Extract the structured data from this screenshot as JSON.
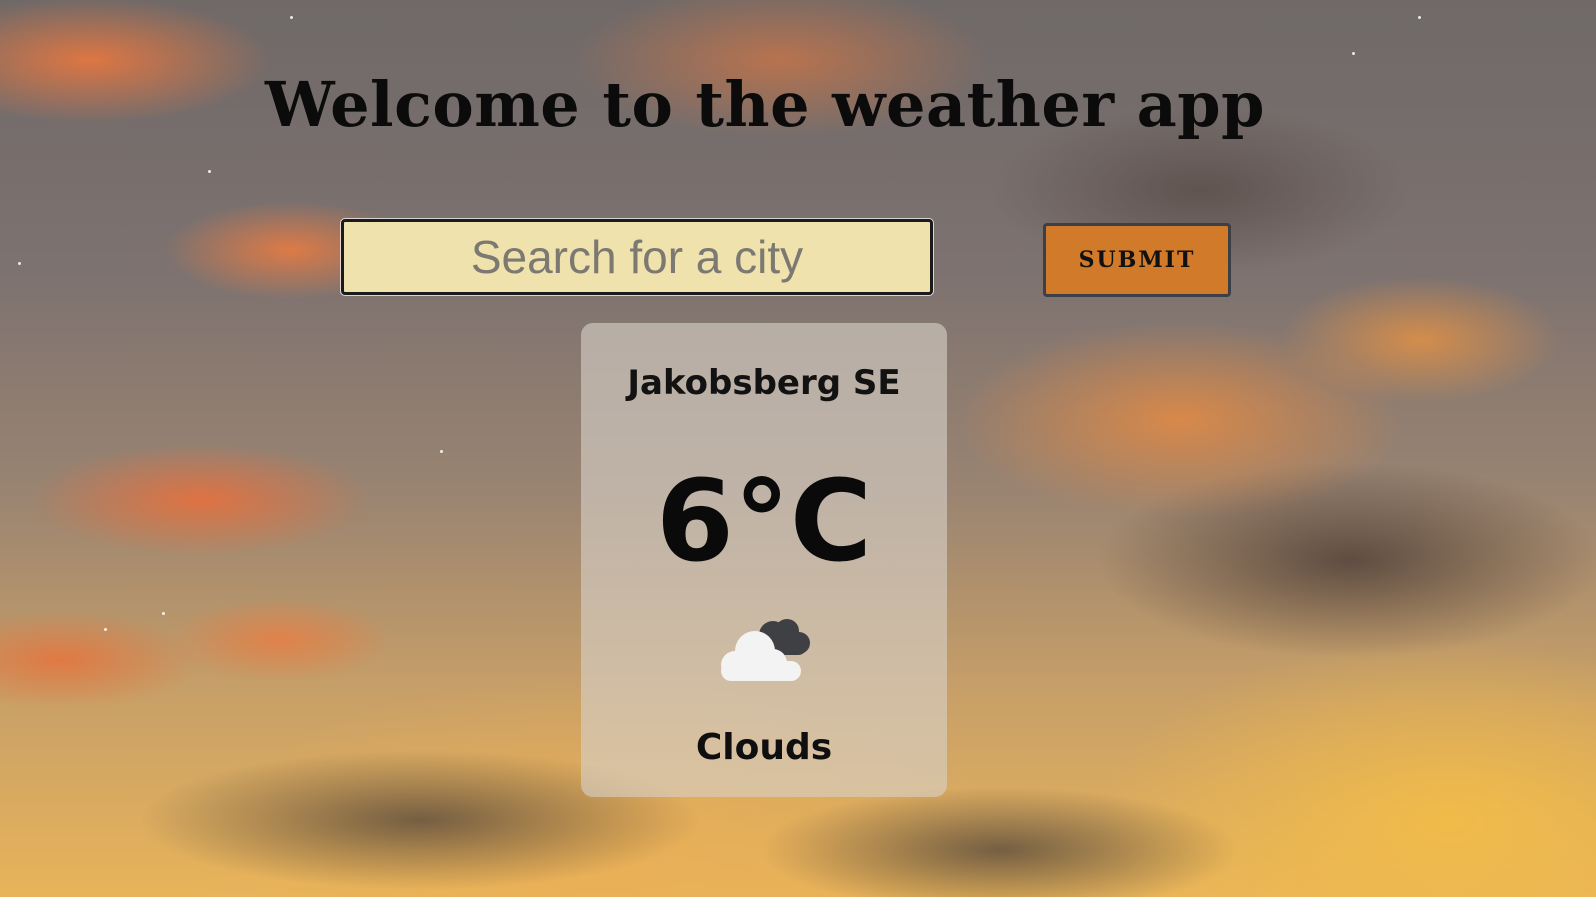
{
  "header": {
    "title": "Welcome to the weather app"
  },
  "search": {
    "placeholder": "Search for a city",
    "value": ""
  },
  "submit": {
    "label": "SUBMIT"
  },
  "weather_card": {
    "city": "Jakobsberg SE",
    "temperature": "6°C",
    "icon": "clouds-icon",
    "description": "Clouds"
  },
  "colors": {
    "input_background": "#efe2ac",
    "button_background": "#d07a2a",
    "card_background": "rgba(215,208,200,0.62)"
  }
}
